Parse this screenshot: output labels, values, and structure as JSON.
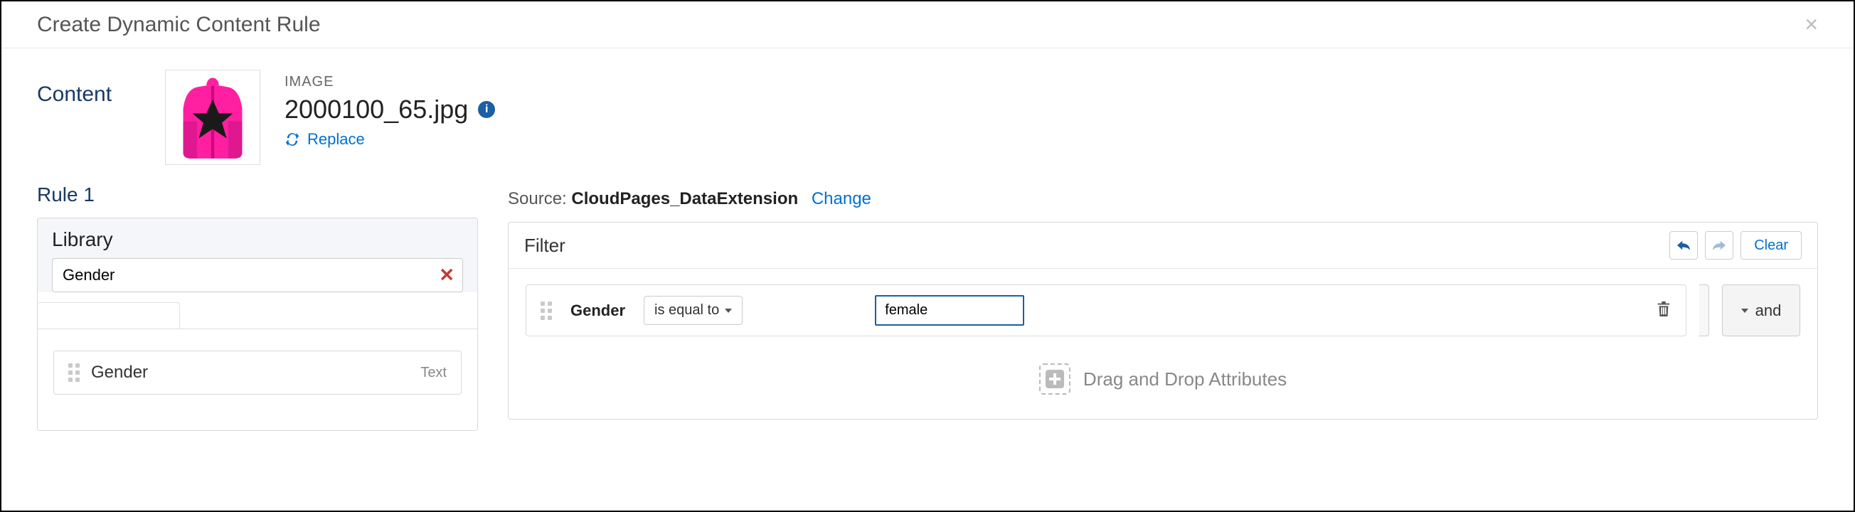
{
  "modal": {
    "title": "Create Dynamic Content Rule"
  },
  "content": {
    "label": "Content",
    "asset_type": "IMAGE",
    "filename": "2000100_65.jpg",
    "replace_label": "Replace"
  },
  "rule": {
    "label": "Rule 1"
  },
  "library": {
    "title": "Library",
    "search_value": "Gender",
    "attributes": [
      {
        "name": "Gender",
        "type": "Text"
      }
    ]
  },
  "source": {
    "label": "Source:",
    "name": "CloudPages_DataExtension",
    "change_label": "Change"
  },
  "filter": {
    "title": "Filter",
    "clear_label": "Clear",
    "condition": {
      "attribute": "Gender",
      "operator": "is equal to",
      "value": "female"
    },
    "logic_operator": "and",
    "drop_hint": "Drag and Drop Attributes"
  }
}
